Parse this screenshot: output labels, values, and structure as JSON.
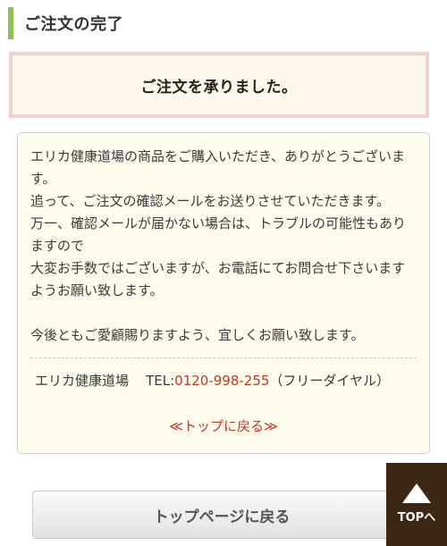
{
  "section": {
    "title": "ご注文の完了"
  },
  "banner": {
    "message": "ご注文を承りました。"
  },
  "message_box": {
    "lines": [
      "エリカ健康道場の商品をご購入いただき、ありがとうございます。",
      "追って、ご注文の確認メールをお送りさせていただきます。",
      "万一、確認メールが届かない場合は、トラブルの可能性もありますので",
      "大変お手数ではございますが、お電話にてお問合せ下さいますようお願い致します。"
    ],
    "closing": "今後ともご愛顧賜りますよう、宜しくお願い致します。"
  },
  "contact": {
    "shop_name": "エリカ健康道場",
    "tel_label": "TEL:",
    "tel_number": "0120-998-255",
    "tel_note": "（フリーダイヤル）"
  },
  "links": {
    "back_to_top": "≪トップに戻る≫"
  },
  "buttons": {
    "top_page": "トップページに戻る",
    "top_float": "TOPへ"
  }
}
